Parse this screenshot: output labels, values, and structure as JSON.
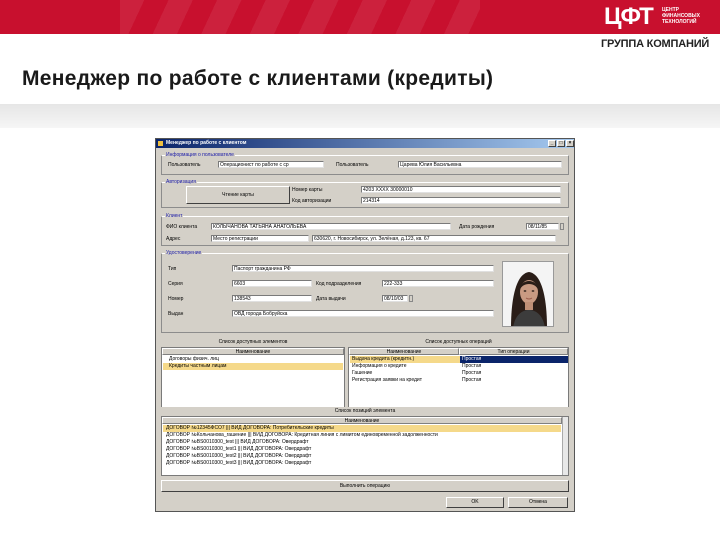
{
  "slide": {
    "logo_text": "ЦФТ",
    "logo_small_lines": [
      "ЦЕНТР",
      "ФИНАНСОВЫХ",
      "ТЕХНОЛОГИЙ"
    ],
    "group_label": "ГРУППА КОМПАНИЙ",
    "title": "Менеджер по работе с клиентами (кредиты)",
    "brand_color": "#c8102e"
  },
  "window": {
    "title": "Менеджер по работе с клиентом",
    "user_info": {
      "legend": "Информация о пользователе",
      "user_label": "Пользователь",
      "user_value": "Операционист по работе с ср",
      "user_right_label": "Пользователь",
      "user_right_value": "Царева Юлия Васильевна"
    },
    "auth": {
      "legend": "Авторизация",
      "read_card_button": "Чтение карты",
      "card_number_label": "Номер карты",
      "card_number_value": "4203 ХХХХ 30000010",
      "auth_code_label": "Код авторизации",
      "auth_code_value": "214314"
    },
    "client": {
      "legend": "Клиент",
      "fio_label": "ФИО клиента",
      "fio_value": "КОЛЫЧАНОВА ТАТЬЯНА АНАТОЛЬЕВА",
      "birth_label": "Дата рождения",
      "birth_value": "08/11/85",
      "address_label": "Адрес",
      "address_type": "Место регистрации",
      "address_value": "630620, г. Новосибирск, ул. Зелёная, д.123, кв. 67"
    },
    "doc": {
      "legend": "Удостоверение",
      "type_label": "Тип",
      "type_value": "Паспорт гражданина РФ",
      "series_label": "Серия",
      "series_value": "6603",
      "division_code_label": "Код подразделения",
      "division_code_value": "222-333",
      "number_label": "Номер",
      "number_value": "138543",
      "issue_date_label": "Дата выдачи",
      "issue_date_value": "08/10/03",
      "issued_by_label": "Выдан",
      "issued_by_value": "ОВД города Бобруйска"
    },
    "elements_list": {
      "caption": "Список доступных элементов",
      "header": "Наименование",
      "rows": [
        {
          "name": "Договоры физич. лиц",
          "selected": false
        },
        {
          "name": "Кредиты частным лицам",
          "selected": true
        }
      ]
    },
    "operations_list": {
      "caption": "Список доступных операций",
      "header_name": "Наименование",
      "header_type": "Тип операции",
      "rows": [
        {
          "name": "Выдача кредита (кредитн.)",
          "type": "Простая",
          "selected": true
        },
        {
          "name": "Информация о кредите",
          "type": "Простая",
          "selected": false
        },
        {
          "name": "Гашение",
          "type": "Простая",
          "selected": false
        },
        {
          "name": "Регистрация заявки на кредит",
          "type": "Простая",
          "selected": false
        }
      ]
    },
    "accounts_list": {
      "caption": "Список позиций элемента",
      "header": "Наименование",
      "rows": [
        {
          "name": "ДОГОВОР №12345ФСО7 ||| ВИД ДОГОВОРА: Потребительские кредиты",
          "selected": true
        },
        {
          "name": "ДОГОВОР №Кольчанова_гашение ||| ВИД ДОГОВОРА: Кредитная линия с лимитом единовременной задолженности",
          "selected": false
        },
        {
          "name": "ДОГОВОР №BS0010300_test ||| ВИД ДОГОВОРА: Овердрафт",
          "selected": false
        },
        {
          "name": "ДОГОВОР №BS0010300_test1 ||| ВИД ДОГОВОРА: Овердрафт",
          "selected": false
        },
        {
          "name": "ДОГОВОР №BS0010300_test2 ||| ВИД ДОГОВОРА: Овердрафт",
          "selected": false
        },
        {
          "name": "ДОГОВОР №BS0010300_test3 ||| ВИД ДОГОВОРА: Овердрафт",
          "selected": false
        }
      ]
    },
    "execute_button": "Выполнить операцию",
    "ok_button": "OK",
    "cancel_button": "Отмена"
  }
}
